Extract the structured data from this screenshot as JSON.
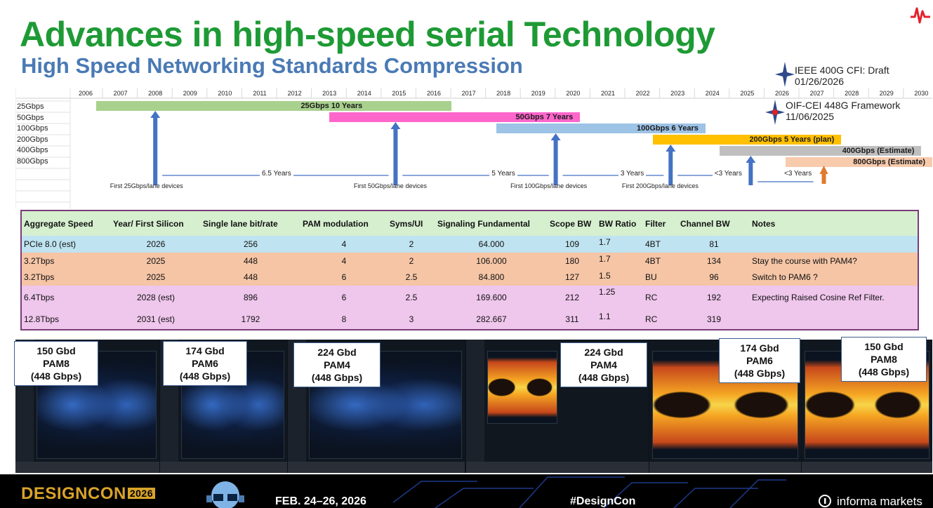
{
  "header": {
    "title": "Advances in high-speed serial Technology",
    "subtitle": "High Speed Networking Standards Compression"
  },
  "notes": [
    {
      "line1": "IEEE  400G CFI: Draft",
      "line2": "01/26/2026"
    },
    {
      "line1": "OIF-CEI 448G Framework",
      "line2": "11/06/2025"
    }
  ],
  "timeline": {
    "years": [
      "2006",
      "2007",
      "2008",
      "2009",
      "2010",
      "2011",
      "2012",
      "2013",
      "2014",
      "2015",
      "2016",
      "2017",
      "2018",
      "2019",
      "2020",
      "2021",
      "2022",
      "2023",
      "2024",
      "2025",
      "2026",
      "2027",
      "2028",
      "2029",
      "2030"
    ],
    "rows": [
      "25Gbps",
      "50Gbps",
      "100Gbps",
      "200Gbps",
      "400Gbps",
      "800Gbps"
    ],
    "bars": [
      {
        "label": "25Gbps   10 Years",
        "start": 2006.3,
        "end": 2016.5,
        "color": "#a9d18e"
      },
      {
        "label": "50Gbps   7 Years",
        "start": 2013.0,
        "end": 2020.2,
        "color": "#ff66cc"
      },
      {
        "label": "100Gbps   6 Years",
        "start": 2017.8,
        "end": 2023.8,
        "color": "#9dc3e6"
      },
      {
        "label": "200Gbps  5 Years (plan)",
        "start": 2022.3,
        "end": 2027.7,
        "color": "#ffc000"
      },
      {
        "label": "400Gbps (Estimate)",
        "start": 2024.2,
        "end": 2030.0,
        "color": "#bfbfbf"
      },
      {
        "label": "800Gbps (Estimate)",
        "start": 2026.1,
        "end": 2030.5,
        "color": "#f8cbad"
      }
    ],
    "gaps": [
      "6.5 Years",
      "5 Years",
      "3 Years",
      "<3 Years",
      "<3 Years"
    ],
    "firsts": [
      "First 25Gbps/lane devices",
      "First 50Gbps/lane devices",
      "First 100Gbps/lane devices",
      "First 200Gbps/lane devices"
    ]
  },
  "table": {
    "headers": [
      "Aggregate Speed",
      "Year/  First Silicon",
      "Single lane bit/rate",
      "PAM modulation",
      "Syms/UI",
      "Signaling Fundamental",
      "Scope BW",
      "BW Ratio",
      "Filter",
      "Channel BW",
      "Notes"
    ],
    "rows": [
      [
        "PCIe 8.0 (est)",
        "2026",
        "256",
        "4",
        "2",
        "64.000",
        "109",
        "1.7",
        "4BT",
        "81",
        ""
      ],
      [
        "3.2Tbps",
        "2025",
        "448",
        "4",
        "2",
        "106.000",
        "180",
        "1.7",
        "4BT",
        "134",
        "Stay the course with PAM4?"
      ],
      [
        "3.2Tbps",
        "2025",
        "448",
        "6",
        "2.5",
        "84.800",
        "127",
        "1.5",
        "BU",
        "96",
        "Switch to  PAM6 ?"
      ],
      [
        "6.4Tbps",
        "2028 (est)",
        "896",
        "6",
        "2.5",
        "169.600",
        "212",
        "1.25",
        "RC",
        "192",
        "Expecting Raised Cosine Ref Filter."
      ],
      [
        "12.8Tbps",
        "2031 (est)",
        "1792",
        "8",
        "3",
        "282.667",
        "311",
        "1.1",
        "RC",
        "319",
        ""
      ]
    ]
  },
  "eye_labels": [
    {
      "baud": "150 Gbd",
      "mod": "PAM8",
      "rate": "(448 Gbps)"
    },
    {
      "baud": "174 Gbd",
      "mod": "PAM6",
      "rate": "(448 Gbps)"
    },
    {
      "baud": "224 Gbd",
      "mod": "PAM4",
      "rate": "(448 Gbps)"
    },
    {
      "baud": "224 Gbd",
      "mod": "PAM4",
      "rate": "(448 Gbps)"
    },
    {
      "baud": "174 Gbd",
      "mod": "PAM6",
      "rate": "(448 Gbps)"
    },
    {
      "baud": "150 Gbd",
      "mod": "PAM8",
      "rate": "(448 Gbps)"
    }
  ],
  "footer": {
    "logo": "DESIGNCON",
    "logo_year": "2026",
    "dates": "FEB. 24–26, 2026",
    "hashtag": "#DesignCon",
    "organizer": "informa markets"
  },
  "colors": {
    "title": "#1e9a35",
    "subtitle": "#4a7ab5",
    "arrow": "#4472c4"
  }
}
